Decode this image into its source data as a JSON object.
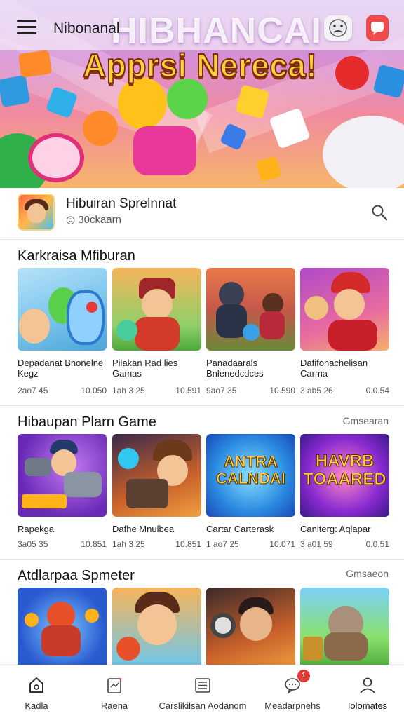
{
  "header": {
    "app_name": "Nibonanal",
    "hero_word": "HIBHANCAI",
    "hero_headline": "Apprsi Nereca!",
    "icons": [
      "menu-icon",
      "face-icon",
      "chat-icon"
    ]
  },
  "featured": {
    "title": "Hibuiran Sprelnnat",
    "subtitle": "◎ 30ckaarn",
    "icon": "search-icon"
  },
  "sections": [
    {
      "title": "Karkraisa Mfiburan",
      "more": "",
      "cards": [
        {
          "label": "Depadanat Bnonelne Kegz",
          "meta_left": "2ao7 45",
          "meta_right": "10.050"
        },
        {
          "label": "Pilakan Rad lies Gamas",
          "meta_left": "1ah 3 25",
          "meta_right": "10.591"
        },
        {
          "label": "Panadaarals Bnlenedcdces",
          "meta_left": "9ao7 35",
          "meta_right": "10.590"
        },
        {
          "label": "Dafifonachelisan Carma",
          "meta_left": "3 ab5 26",
          "meta_right": "0.0.54"
        }
      ]
    },
    {
      "title": "Hibaupan Plarn Game",
      "more": "Gmsearan",
      "cards": [
        {
          "label": "Rapekga",
          "meta_left": "3a05 35",
          "meta_right": "10.851",
          "art_text": ""
        },
        {
          "label": "Dafhe Mnulbea",
          "meta_left": "1ah 3 25",
          "meta_right": "10.851",
          "art_text": ""
        },
        {
          "label": "Cartar Carterask",
          "meta_left": "1 ao7 25",
          "meta_right": "10.071",
          "art_text": "ANTRA CALNDAI"
        },
        {
          "label": "Canlterg: Aqlapar",
          "meta_left": "3 a01 59",
          "meta_right": "0.0.51",
          "art_text": "HAVRB TOAARED"
        }
      ]
    },
    {
      "title": "Atdlarpaa Spmeter",
      "more": "Gmsaeon",
      "cards": []
    }
  ],
  "bottom_nav": [
    {
      "label": "Kadla",
      "icon": "home-icon",
      "active": false
    },
    {
      "label": "Raena",
      "icon": "apps-icon",
      "active": false
    },
    {
      "label": "Carslikilsan Aodanom",
      "icon": "list-icon",
      "active": false
    },
    {
      "label": "Meadarpnehs",
      "icon": "message-icon",
      "active": false,
      "badge": "1"
    },
    {
      "label": "Iolomates",
      "icon": "profile-icon",
      "active": true
    }
  ],
  "colors": {
    "accent": "#e53935",
    "headline": "#ffd23a",
    "hero_top": "#caa7e8",
    "hero_bottom": "#f7b56a"
  }
}
